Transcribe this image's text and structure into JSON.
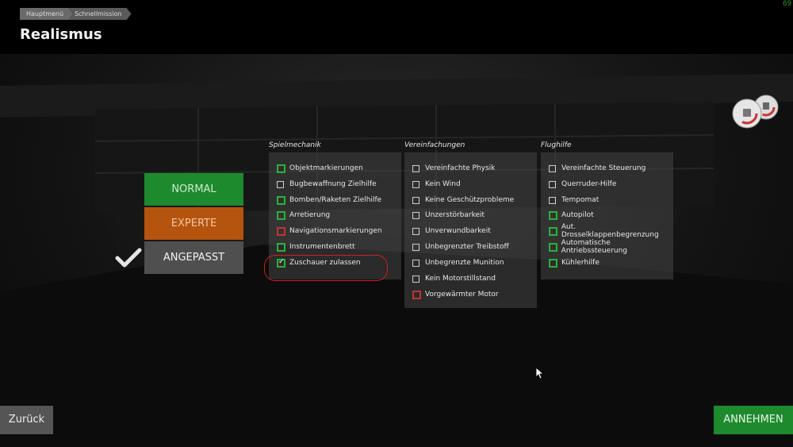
{
  "fps": "69",
  "breadcrumb": [
    "Hauptmenü",
    "Schnellmission"
  ],
  "title": "Realismus",
  "presets": {
    "normal": "NORMAL",
    "experte": "EXPERTE",
    "angepasst": "ANGEPASST",
    "selected": "angepasst"
  },
  "columns": [
    {
      "title": "Spielmechanik",
      "items": [
        {
          "label": "Objektmarkierungen",
          "state": "green",
          "checked": false
        },
        {
          "label": "Bugbewaffnung Zielhilfe",
          "state": "plain",
          "checked": false
        },
        {
          "label": "Bomben/Raketen Zielhilfe",
          "state": "green",
          "checked": false
        },
        {
          "label": "Arretierung",
          "state": "green",
          "checked": false
        },
        {
          "label": "Navigationsmarkierungen",
          "state": "red",
          "checked": false
        },
        {
          "label": "Instrumentenbrett",
          "state": "green",
          "checked": false
        },
        {
          "label": "Zuschauer zulassen",
          "state": "green",
          "checked": true
        }
      ]
    },
    {
      "title": "Vereinfachungen",
      "items": [
        {
          "label": "Vereinfachte Physik",
          "state": "plain",
          "checked": false
        },
        {
          "label": "Kein Wind",
          "state": "plain",
          "checked": false
        },
        {
          "label": "Keine Geschützprobleme",
          "state": "plain",
          "checked": false
        },
        {
          "label": "Unzerstörbarkeit",
          "state": "plain",
          "checked": false
        },
        {
          "label": "Unverwundbarkeit",
          "state": "plain",
          "checked": false
        },
        {
          "label": "Unbegrenzter Treibstoff",
          "state": "plain",
          "checked": false
        },
        {
          "label": "Unbegrenzte Munition",
          "state": "plain",
          "checked": false
        },
        {
          "label": "Kein Motorstillstand",
          "state": "plain",
          "checked": false
        },
        {
          "label": "Vorgewärmter Motor",
          "state": "red",
          "checked": false
        }
      ]
    },
    {
      "title": "Flughilfe",
      "items": [
        {
          "label": "Vereinfachte Steuerung",
          "state": "plain",
          "checked": false
        },
        {
          "label": "Querruder-Hilfe",
          "state": "plain",
          "checked": false
        },
        {
          "label": "Tempomat",
          "state": "plain",
          "checked": false
        },
        {
          "label": "Autopilot",
          "state": "green",
          "checked": false
        },
        {
          "label": "Aut. Drosselklappenbegrenzung",
          "state": "green",
          "checked": false
        },
        {
          "label": "Automatische Antriebssteuerung",
          "state": "green",
          "checked": false
        },
        {
          "label": "Kühlerhilfe",
          "state": "green",
          "checked": false
        }
      ]
    }
  ],
  "buttons": {
    "back": "Zurück",
    "accept": "ANNEHMEN"
  },
  "colors": {
    "green": "#1e8a2e",
    "orange": "#b5540f",
    "gray": "#4f4f4f",
    "red": "#d11f1f"
  }
}
